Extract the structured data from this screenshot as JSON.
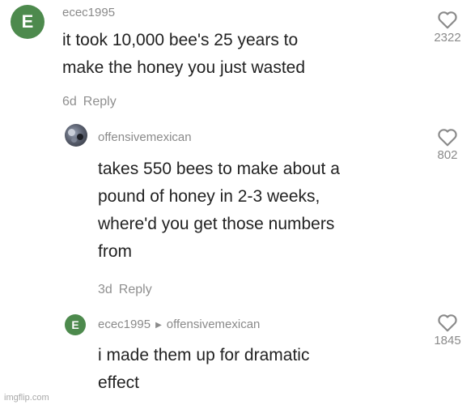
{
  "comments": [
    {
      "avatar_letter": "E",
      "username": "ecec1995",
      "lines": [
        "it took 10,000 bee's 25 years to",
        "make the honey you just wasted"
      ],
      "age": "6d",
      "reply_label": "Reply",
      "likes": "2322"
    },
    {
      "username": "offensivemexican",
      "lines": [
        "takes 550 bees to make about a",
        "pound of honey in 2-3 weeks,",
        "where'd you get those numbers",
        "from"
      ],
      "age": "3d",
      "reply_label": "Reply",
      "likes": "802"
    },
    {
      "avatar_letter": "E",
      "username": "ecec1995",
      "reply_to": "offensivemexican",
      "lines": [
        "i made them up for dramatic",
        "effect"
      ],
      "likes": "1845"
    }
  ],
  "watermark": "imgflip.com",
  "colors": {
    "avatar_green": "#4d8a4d",
    "muted_text": "#8a8a8a",
    "body_text": "#222222"
  }
}
